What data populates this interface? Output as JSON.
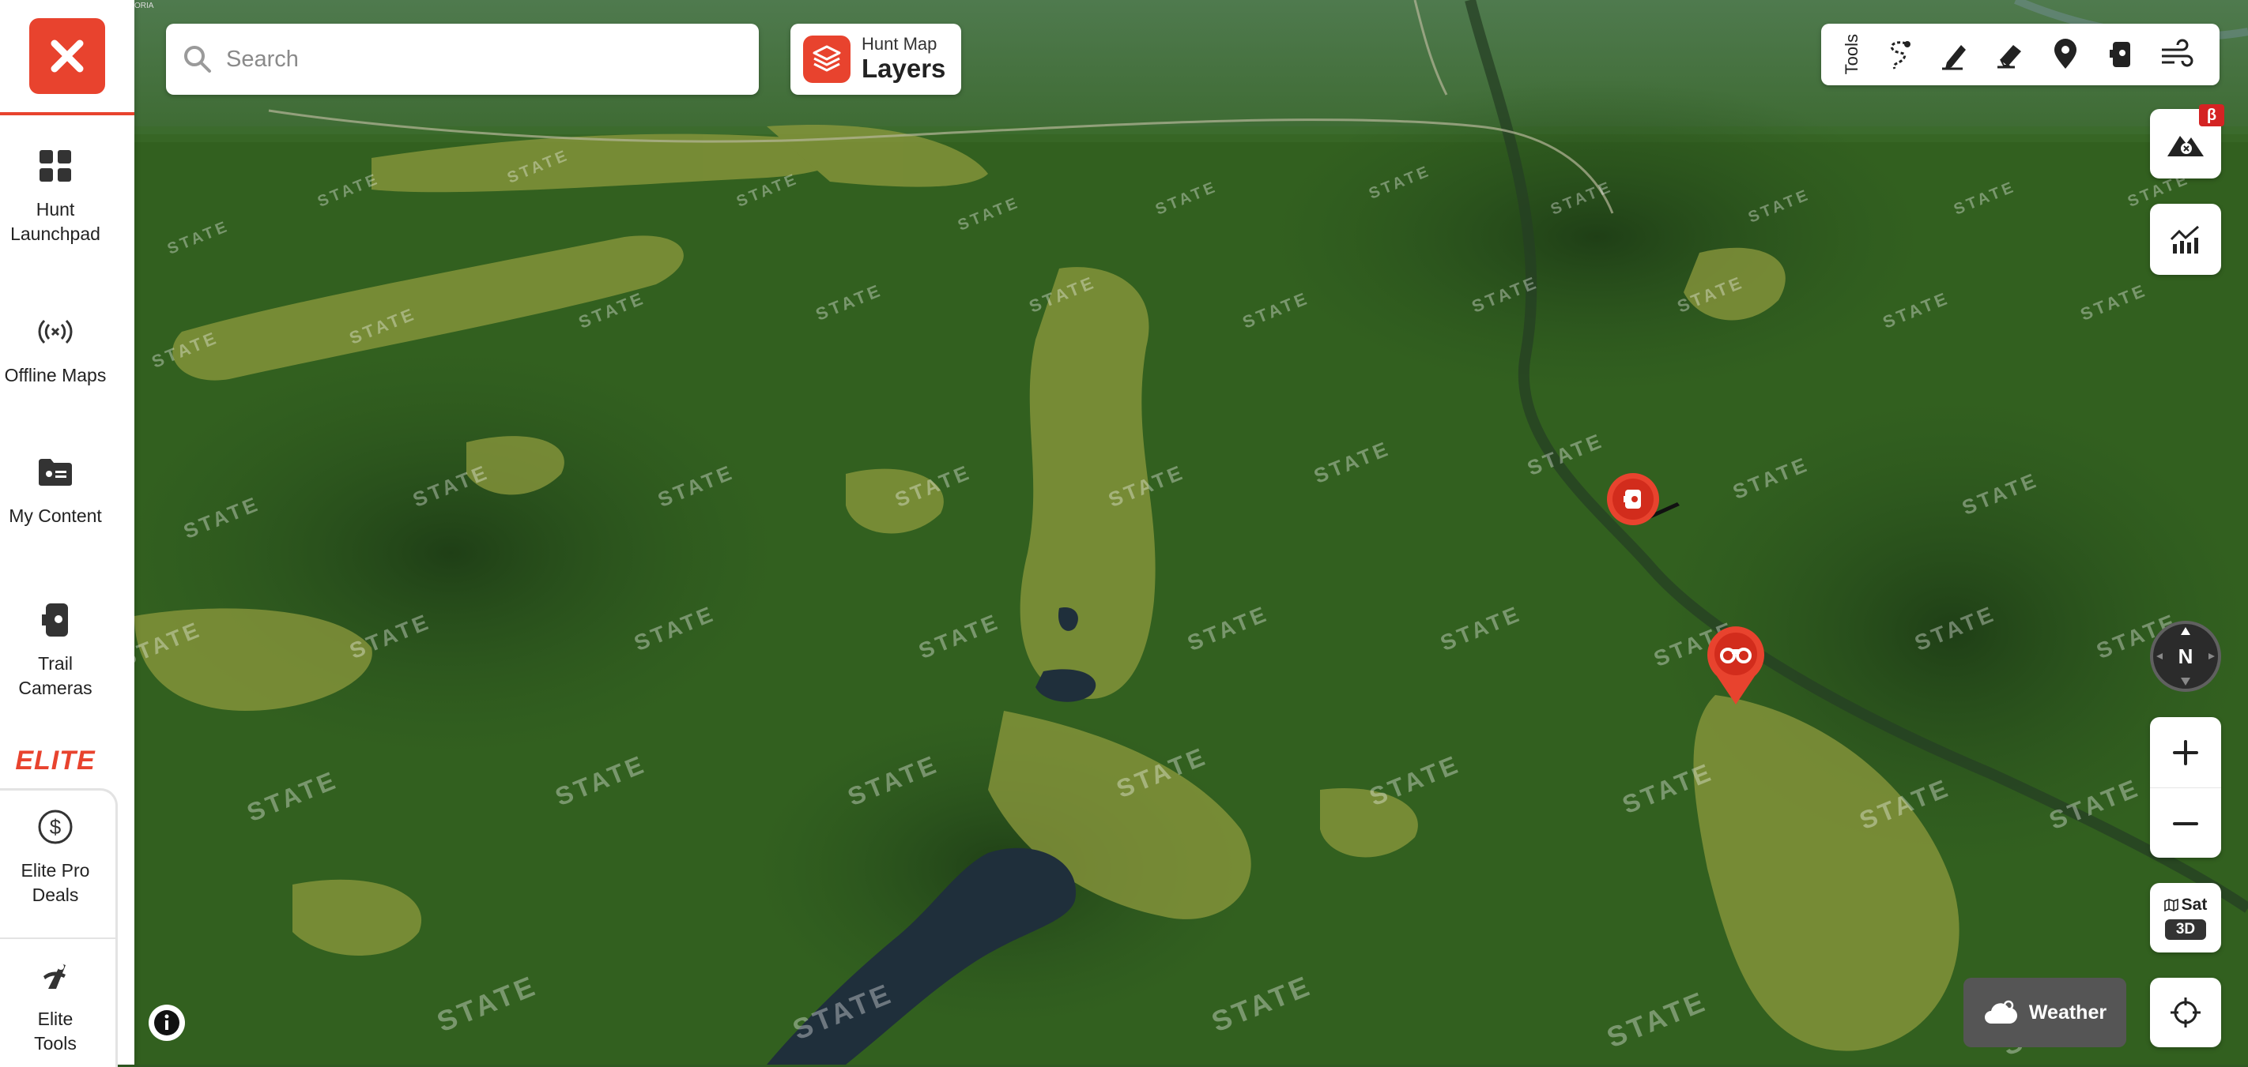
{
  "sidebar": {
    "close_button": "close",
    "items": [
      {
        "label": "Hunt\nLaunchpad",
        "icon": "grid-icon"
      },
      {
        "label": "Offline Maps",
        "icon": "offline-signal-icon"
      },
      {
        "label": "My Content",
        "icon": "folder-icon"
      },
      {
        "label": "Trail Cameras",
        "icon": "trail-camera-icon"
      }
    ],
    "elite_logo": "ELITE",
    "elite_items": [
      {
        "label": "Elite Pro\nDeals",
        "icon": "dollar-icon"
      },
      {
        "label": "Elite\nTools",
        "icon": "elite-tools-icon"
      }
    ]
  },
  "search": {
    "placeholder": "Search",
    "value": ""
  },
  "layers_button": {
    "subtitle": "Hunt Map",
    "title": "Layers"
  },
  "toolbar": {
    "label": "Tools",
    "tools": [
      "lasso-icon",
      "pen-icon",
      "eraser-icon",
      "location-pin-icon",
      "trail-camera-icon",
      "wind-icon"
    ]
  },
  "right_controls": {
    "terrain_beta_badge": "β",
    "compass_label": "N",
    "basemap": {
      "label": "Sat",
      "mode": "3D"
    },
    "weather_label": "Weather"
  },
  "map": {
    "corner_text": "ORIA",
    "state_label": "STATE",
    "accent_color": "#e8432e",
    "pins": [
      {
        "type": "trail-camera",
        "color": "#e8432e"
      },
      {
        "type": "binoculars",
        "color": "#e8432e"
      }
    ]
  }
}
